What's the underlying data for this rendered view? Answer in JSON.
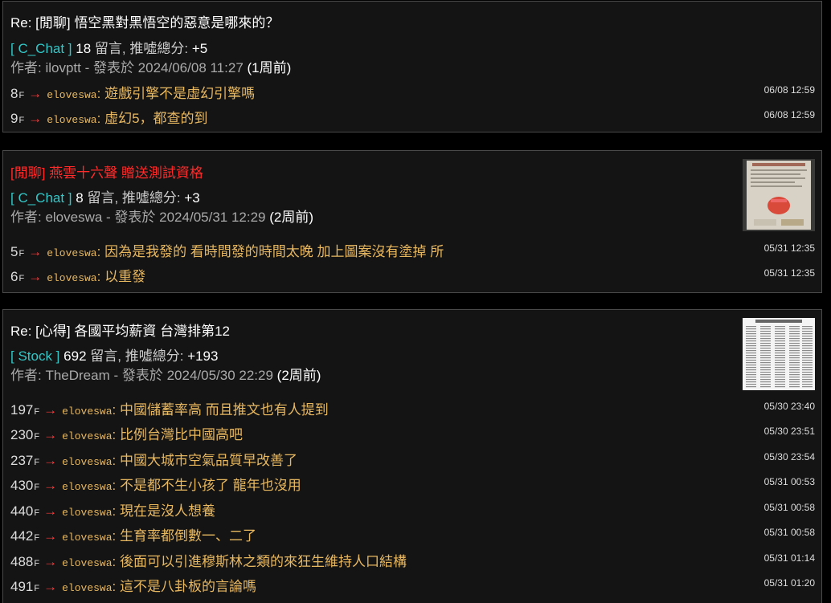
{
  "posts": [
    {
      "title": "Re: [閒聊] 悟空黑對黑悟空的惡意是哪來的？",
      "board": "[ C_Chat ]",
      "comment_count": "18",
      "comment_label": " 留言, 推噓總分: ",
      "score": "+5",
      "author_line": "作者: ilovptt - 發表於 2024/06/08 11:27",
      "ago": "(1周前)",
      "pushes": [
        {
          "floor": "8",
          "user": "eloveswa",
          "content": ": 遊戲引擎不是虛幻引擎嗎",
          "time": "06/08 12:59"
        },
        {
          "floor": "9",
          "user": "eloveswa",
          "content": ": 虛幻5，都查的到",
          "time": "06/08 12:59"
        }
      ]
    },
    {
      "title": "[閒聊] 燕雲十六聲 贈送測試資格",
      "board": "[ C_Chat ]",
      "comment_count": "8",
      "comment_label": " 留言, 推噓總分: ",
      "score": "+3",
      "author_line": "作者: eloveswa - 發表於 2024/05/31 12:29",
      "ago": "(2周前)",
      "pushes": [
        {
          "floor": "5",
          "user": "eloveswa",
          "content": ": 因為是我發的 看時間發的時間太晚 加上圖案沒有塗掉 所",
          "time": "05/31 12:35"
        },
        {
          "floor": "6",
          "user": "eloveswa",
          "content": ": 以重發",
          "time": "05/31 12:35"
        }
      ]
    },
    {
      "title": "Re: [心得] 各國平均薪資 台灣排第12",
      "board": "[ Stock ]",
      "comment_count": "692",
      "comment_label": " 留言, 推噓總分: ",
      "score": "+193",
      "author_line": "作者: TheDream - 發表於 2024/05/30 22:29",
      "ago": "(2周前)",
      "pushes": [
        {
          "floor": "197",
          "user": "eloveswa",
          "content": ": 中國儲蓄率高 而且推文也有人提到",
          "time": "05/30 23:40"
        },
        {
          "floor": "230",
          "user": "eloveswa",
          "content": ": 比例台灣比中國高吧",
          "time": "05/30 23:51"
        },
        {
          "floor": "237",
          "user": "eloveswa",
          "content": ": 中國大城市空氣品質早改善了",
          "time": "05/30 23:54"
        },
        {
          "floor": "430",
          "user": "eloveswa",
          "content": ": 不是都不生小孩了 龍年也沒用",
          "time": "05/31 00:53"
        },
        {
          "floor": "440",
          "user": "eloveswa",
          "content": ": 現在是沒人想養",
          "time": "05/31 00:58"
        },
        {
          "floor": "442",
          "user": "eloveswa",
          "content": ": 生育率都倒數一、二了",
          "time": "05/31 00:58"
        },
        {
          "floor": "488",
          "user": "eloveswa",
          "content": ": 後面可以引進穆斯林之類的來狂生維持人口結構",
          "time": "05/31 01:14"
        },
        {
          "floor": "491",
          "user": "eloveswa",
          "content": ": 這不是八卦板的言論嗎",
          "time": "05/31 01:20"
        }
      ]
    }
  ],
  "labels": {
    "floor_suffix": "F",
    "arrow": "→"
  },
  "colors": {
    "background": "#000000",
    "card": "#141414",
    "board": "#33c7c7",
    "push_text": "#e8b860",
    "arrow": "#ff3b3b",
    "highlight_title": "#ff2a2a"
  }
}
